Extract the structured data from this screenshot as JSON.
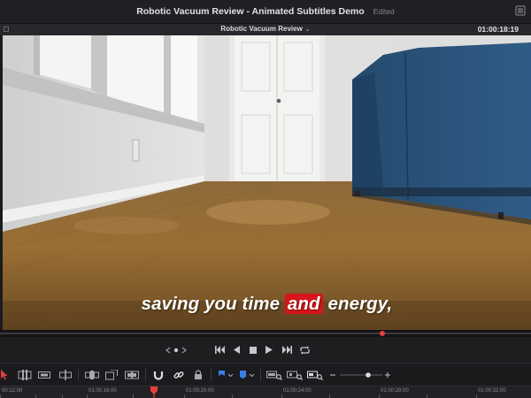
{
  "window": {
    "title": "Robotic Vacuum Review - Animated Subtitles Demo",
    "status": "Edited"
  },
  "viewer": {
    "clip_name": "Robotic Vacuum Review",
    "timecode": "01:00:18:19"
  },
  "subtitle": {
    "before": "saving you time ",
    "highlight": "and",
    "after": " energy,",
    "highlight_color": "#d6161b"
  },
  "playback": {
    "scrub_progress": 0.72
  },
  "transport": [
    {
      "name": "first-frame-button",
      "icon": "skip-to-start-icon"
    },
    {
      "name": "play-reverse-button",
      "icon": "play-reverse-icon"
    },
    {
      "name": "stop-button",
      "icon": "stop-icon"
    },
    {
      "name": "play-button",
      "icon": "play-icon"
    },
    {
      "name": "last-frame-button",
      "icon": "skip-to-end-icon"
    },
    {
      "name": "loop-button",
      "icon": "loop-icon"
    }
  ],
  "ruler": {
    "labels": [
      "00:12:00",
      "01:00:16:00",
      "01:00:20:00",
      "01:00:24:00",
      "01:00:28:00",
      "01:00:32:00"
    ]
  },
  "colors": {
    "accent": "#e5403a",
    "flag_blue": "#3b7fe0",
    "select_tool_red": "#e04040"
  }
}
